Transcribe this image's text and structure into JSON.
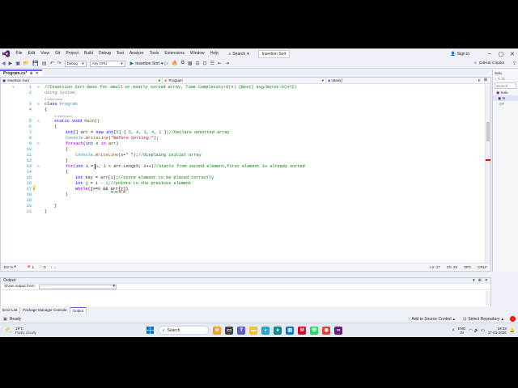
{
  "menubar": {
    "items": [
      "File",
      "Edit",
      "View",
      "Git",
      "Project",
      "Build",
      "Debug",
      "Test",
      "Analyze",
      "Tools",
      "Extensions",
      "Window",
      "Help"
    ],
    "search_label": "Search",
    "solution_name": "Insertion Sort",
    "sign_in": "Sign in"
  },
  "toolbar": {
    "config": "Debug",
    "platform": "Any CPU",
    "run_target": "Insertion Sort",
    "copilot": "GitHub Copilot"
  },
  "doc_tab": {
    "label": "Program.cs*"
  },
  "navbar": {
    "project": "Insertion Sort",
    "class": "Program",
    "member": "Main()"
  },
  "code": {
    "lines": [
      {
        "n": "1",
        "text": "//Insertion Sort-Best for small or nearly sorted array, Time Complexity:O(n) [Best] avg/Worst:O(n^2)"
      },
      {
        "n": "2",
        "text": "using System;"
      },
      {
        "n": "3",
        "text": "class Program"
      },
      {
        "n": "4",
        "text": "{"
      },
      {
        "n": "5",
        "text": "static void Main()"
      },
      {
        "n": "6",
        "text": "{"
      },
      {
        "n": "7",
        "text": "int[] arr = new int[5] { 5, 8, 3, 4, 2 };//Declare unsorted array"
      },
      {
        "n": "8",
        "text": "Console.WriteLine(\"Before Sorting:\");"
      },
      {
        "n": "9",
        "text": "foreach(int x in arr)"
      },
      {
        "n": "10",
        "text": "{"
      },
      {
        "n": "11",
        "text": "Console.WriteLine(x+\" \");//displaing initial array"
      },
      {
        "n": "12",
        "text": "}"
      },
      {
        "n": "13",
        "text": "for(int i = 1; i < arr.Length; i++)//starts from second element,first element is already sorted"
      },
      {
        "n": "14",
        "text": "{"
      },
      {
        "n": "15",
        "text": "int key = arr[i];//store element to be placed correctly"
      },
      {
        "n": "16",
        "text": "int j = i - 1;//points to the previous element"
      },
      {
        "n": "17",
        "text": "while(j>=0 && arr[j])"
      },
      {
        "n": "18",
        "text": "}"
      },
      {
        "n": "19",
        "text": ""
      },
      {
        "n": "20",
        "text": "}"
      },
      {
        "n": "21",
        "text": "}"
      }
    ],
    "refs": {
      "before_class": "0 references",
      "before_main": "0 references"
    }
  },
  "editor_status": {
    "zoom": "112 %",
    "errors": "1",
    "warnings": "0",
    "ln": "Ln: 17",
    "ch": "Ch: 33",
    "spc": "SPC",
    "crlf": "CRLF"
  },
  "rightpanel": {
    "title": "Solu",
    "search": "Search",
    "items": [
      "Solu",
      "In",
      "C#"
    ]
  },
  "output": {
    "title": "Output",
    "show_from": "Show output from:",
    "tabs": [
      "Error List",
      "Package Manager Console",
      "Output"
    ]
  },
  "vsstatus": {
    "ready": "Ready",
    "source_control": "Add to Source Control",
    "repo": "Select Repository"
  },
  "taskbar": {
    "weather_temp": "19°C",
    "weather_desc": "Partly cloudy",
    "search": "Search",
    "lang1": "ENG",
    "lang2": "IN",
    "time": "19:33",
    "date": "17-01-2026"
  },
  "colors": {
    "accent": "#6c5ce7",
    "vs_purple": "#68217a",
    "error_red": "#e51400"
  }
}
